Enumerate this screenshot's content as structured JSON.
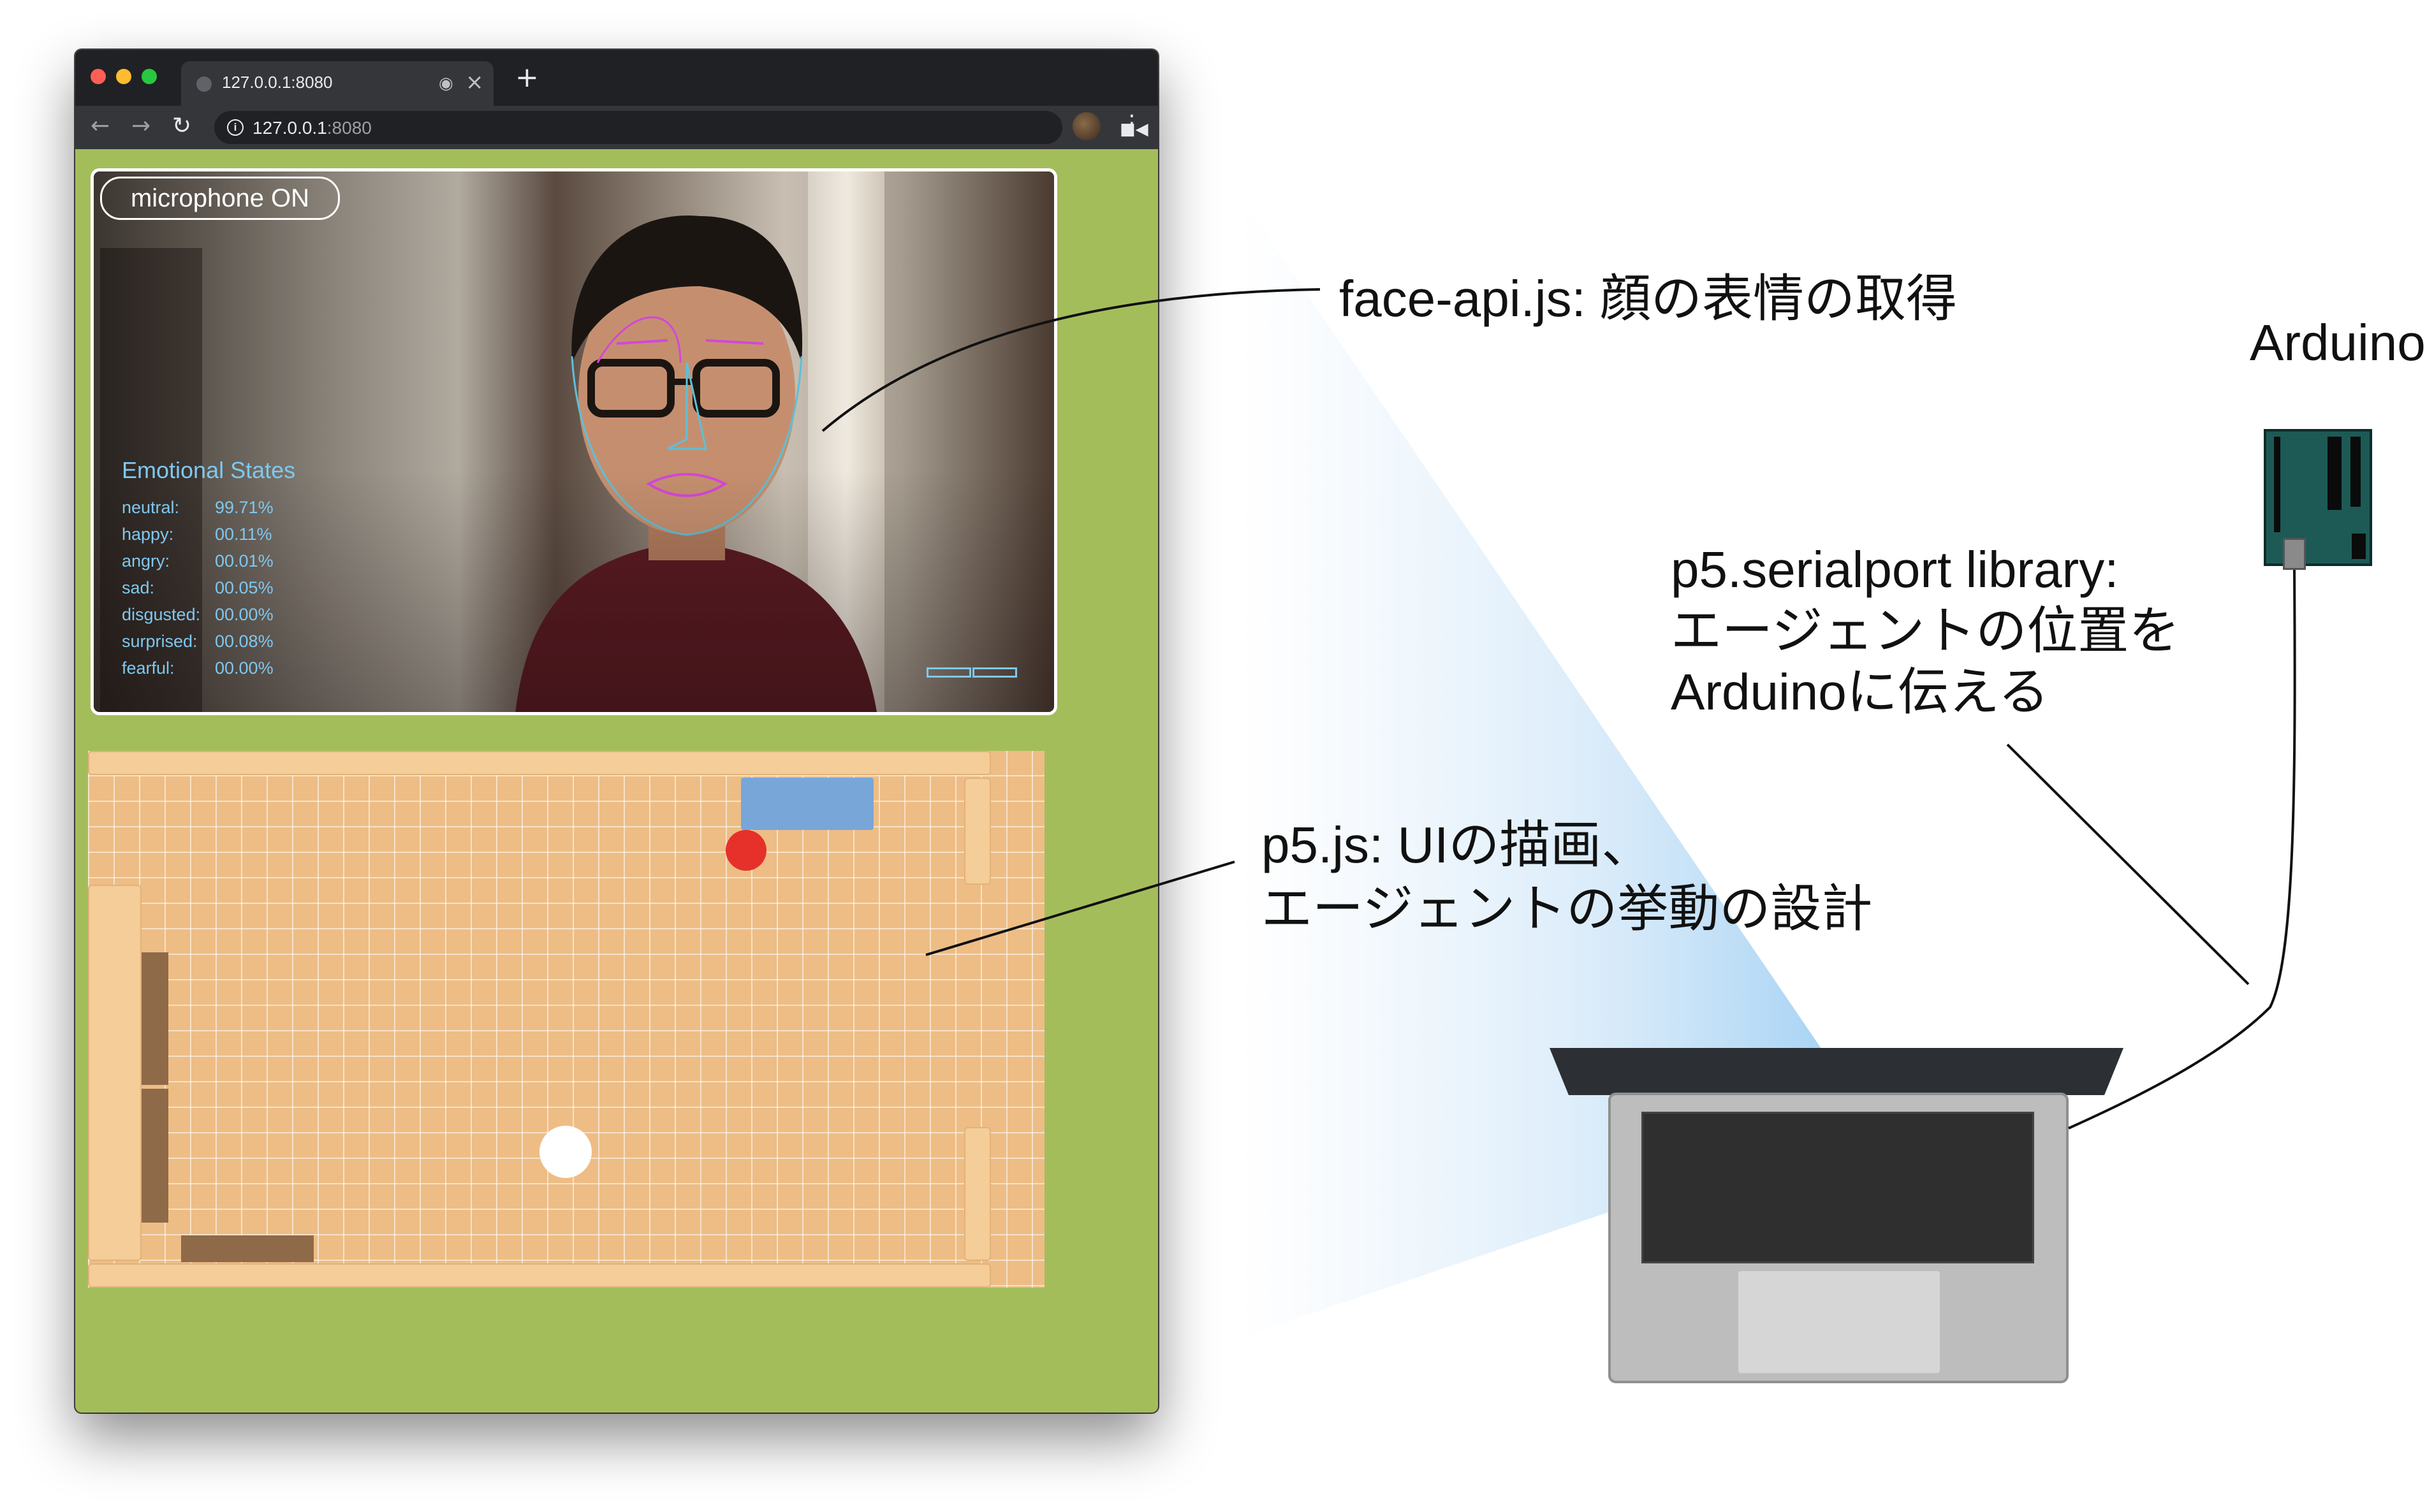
{
  "browser": {
    "tab": {
      "title": "127.0.0.1:8080"
    },
    "address": {
      "host": "127.0.0.1",
      "port": ":8080"
    },
    "traffic_colors": [
      "#ff5f57",
      "#febc2e",
      "#28c840"
    ]
  },
  "video": {
    "microphone_label": "microphone ON",
    "emotions_title": "Emotional States",
    "emotions": [
      {
        "label": "neutral:",
        "value": "99.71%"
      },
      {
        "label": "happy:",
        "value": "00.11%"
      },
      {
        "label": "angry:",
        "value": "00.01%"
      },
      {
        "label": "sad:",
        "value": "00.05%"
      },
      {
        "label": "disgusted:",
        "value": "00.00%"
      },
      {
        "label": "surprised:",
        "value": "00.08%"
      },
      {
        "label": "fearful:",
        "value": "00.00%"
      }
    ]
  },
  "annotations": {
    "face_api": "face-api.js: 顔の表情の取得",
    "p5_line1": "p5.js: UIの描画、",
    "p5_line2": "エージェントの挙動の設計",
    "serial_line1": "p5.serialport library:",
    "serial_line2": "エージェントの位置を",
    "serial_line3": "Arduinoに伝える",
    "arduino": "Arduino"
  },
  "colors": {
    "page_background": "#a4bd5b",
    "floor": "#edbd85",
    "agent_red": "#e5312a",
    "target_blue": "#79a6d8",
    "emotion_text": "#7ec8f0",
    "arduino_board": "#1d5a55"
  },
  "icons": [
    "back-icon",
    "forward-icon",
    "reload-icon",
    "info-icon",
    "camera-icon",
    "star-icon",
    "profile-icon",
    "menu-icon",
    "close-icon",
    "record-icon",
    "plus-icon"
  ]
}
